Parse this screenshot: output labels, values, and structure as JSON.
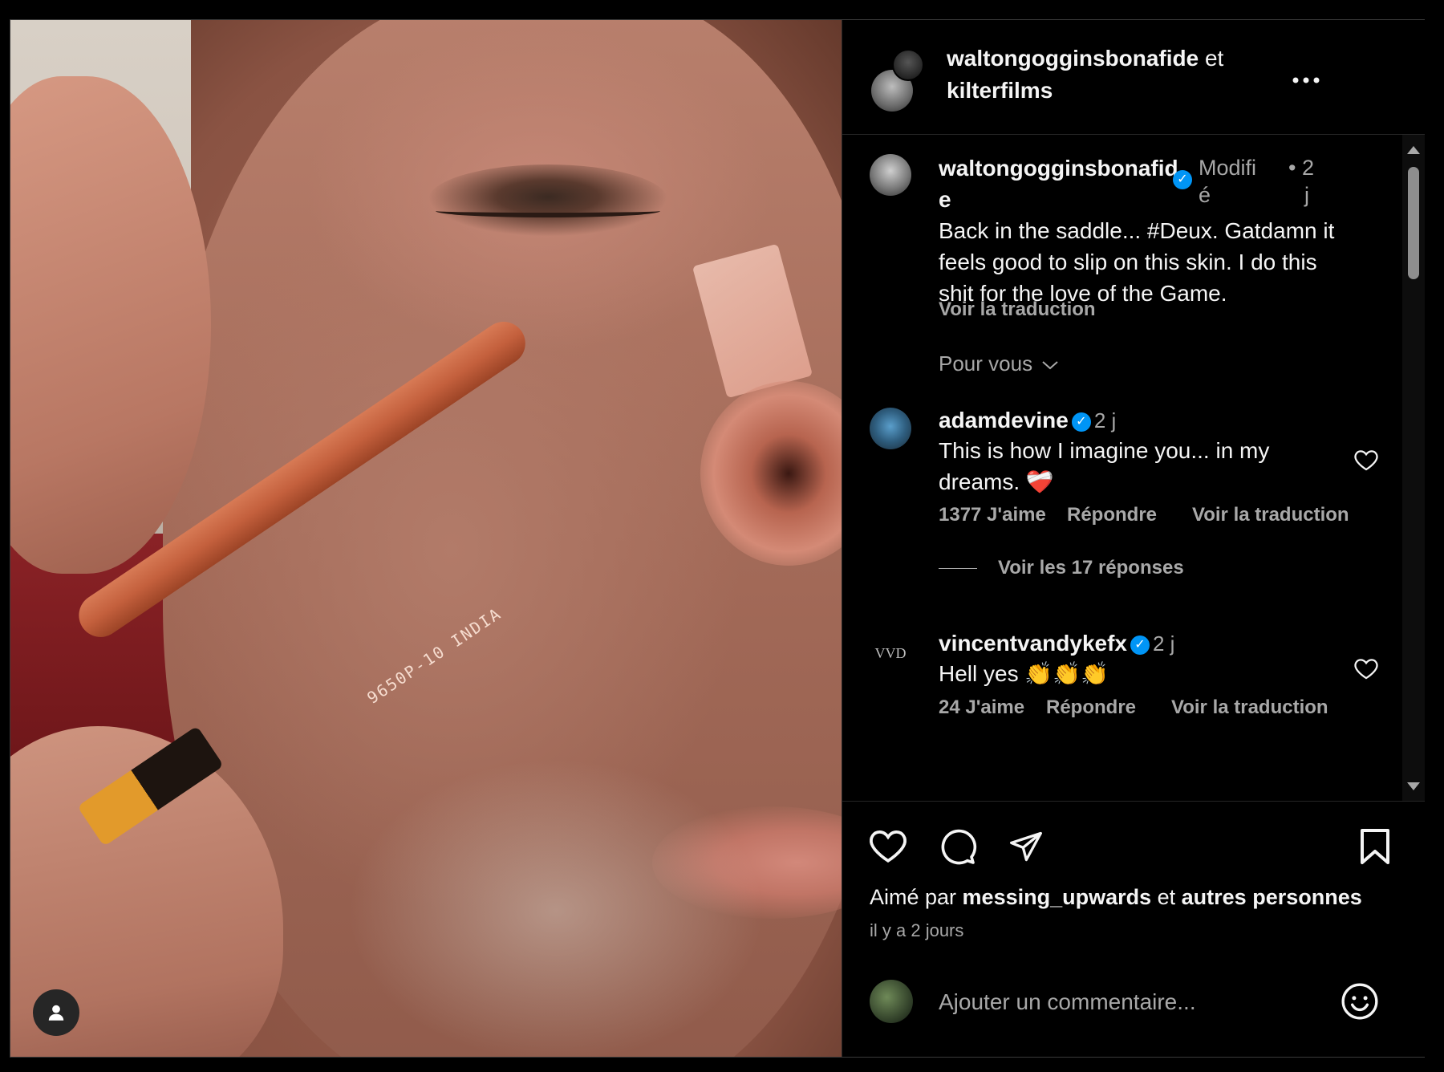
{
  "post": {
    "header": {
      "author": "waltongogginsbonafide",
      "joiner": " et ",
      "coauthor": "kilterfilms",
      "more_icon": "more-horizontal-icon"
    },
    "caption": {
      "user_line1": "waltongogginsbonafid",
      "user_line2": "e",
      "edited_1": "Modifi",
      "edited_2": "é",
      "dot": "•",
      "time_1": "2",
      "time_2": "j",
      "text_1": "Back in the saddle... #Deux. Gatdamn it",
      "text_2": "feels good to slip on this skin. I do this",
      "text_3": "shit for the love of the Game.",
      "translate": "Voir la traduction"
    },
    "for_you": "Pour vous",
    "comments": [
      {
        "user": "adamdevine",
        "time": "2 j",
        "text_1": "This is how I imagine you... in my",
        "text_2": "dreams. ❤️‍🩹",
        "likes": "1377 J'aime",
        "reply": "Répondre",
        "translate": "Voir la traduction",
        "replies": "Voir les 17 réponses"
      },
      {
        "user": "vincentvandykefx",
        "avatar_text": "VVD",
        "time": "2 j",
        "text": "Hell yes 👏👏👏",
        "likes": "24 J'aime",
        "reply": "Répondre",
        "translate": "Voir la traduction"
      }
    ],
    "liked_prefix": "Aimé par ",
    "liked_user": "messing_upwards",
    "liked_mid": " et ",
    "liked_others": "autres personnes",
    "time_ago": "il y a 2 jours",
    "comment_placeholder": "Ajouter un commentaire...",
    "pencil_label": "9650P-10 INDIA",
    "colors": {
      "verified": "#0095f6",
      "muted": "#a8a8a8",
      "bg": "#000000"
    }
  }
}
